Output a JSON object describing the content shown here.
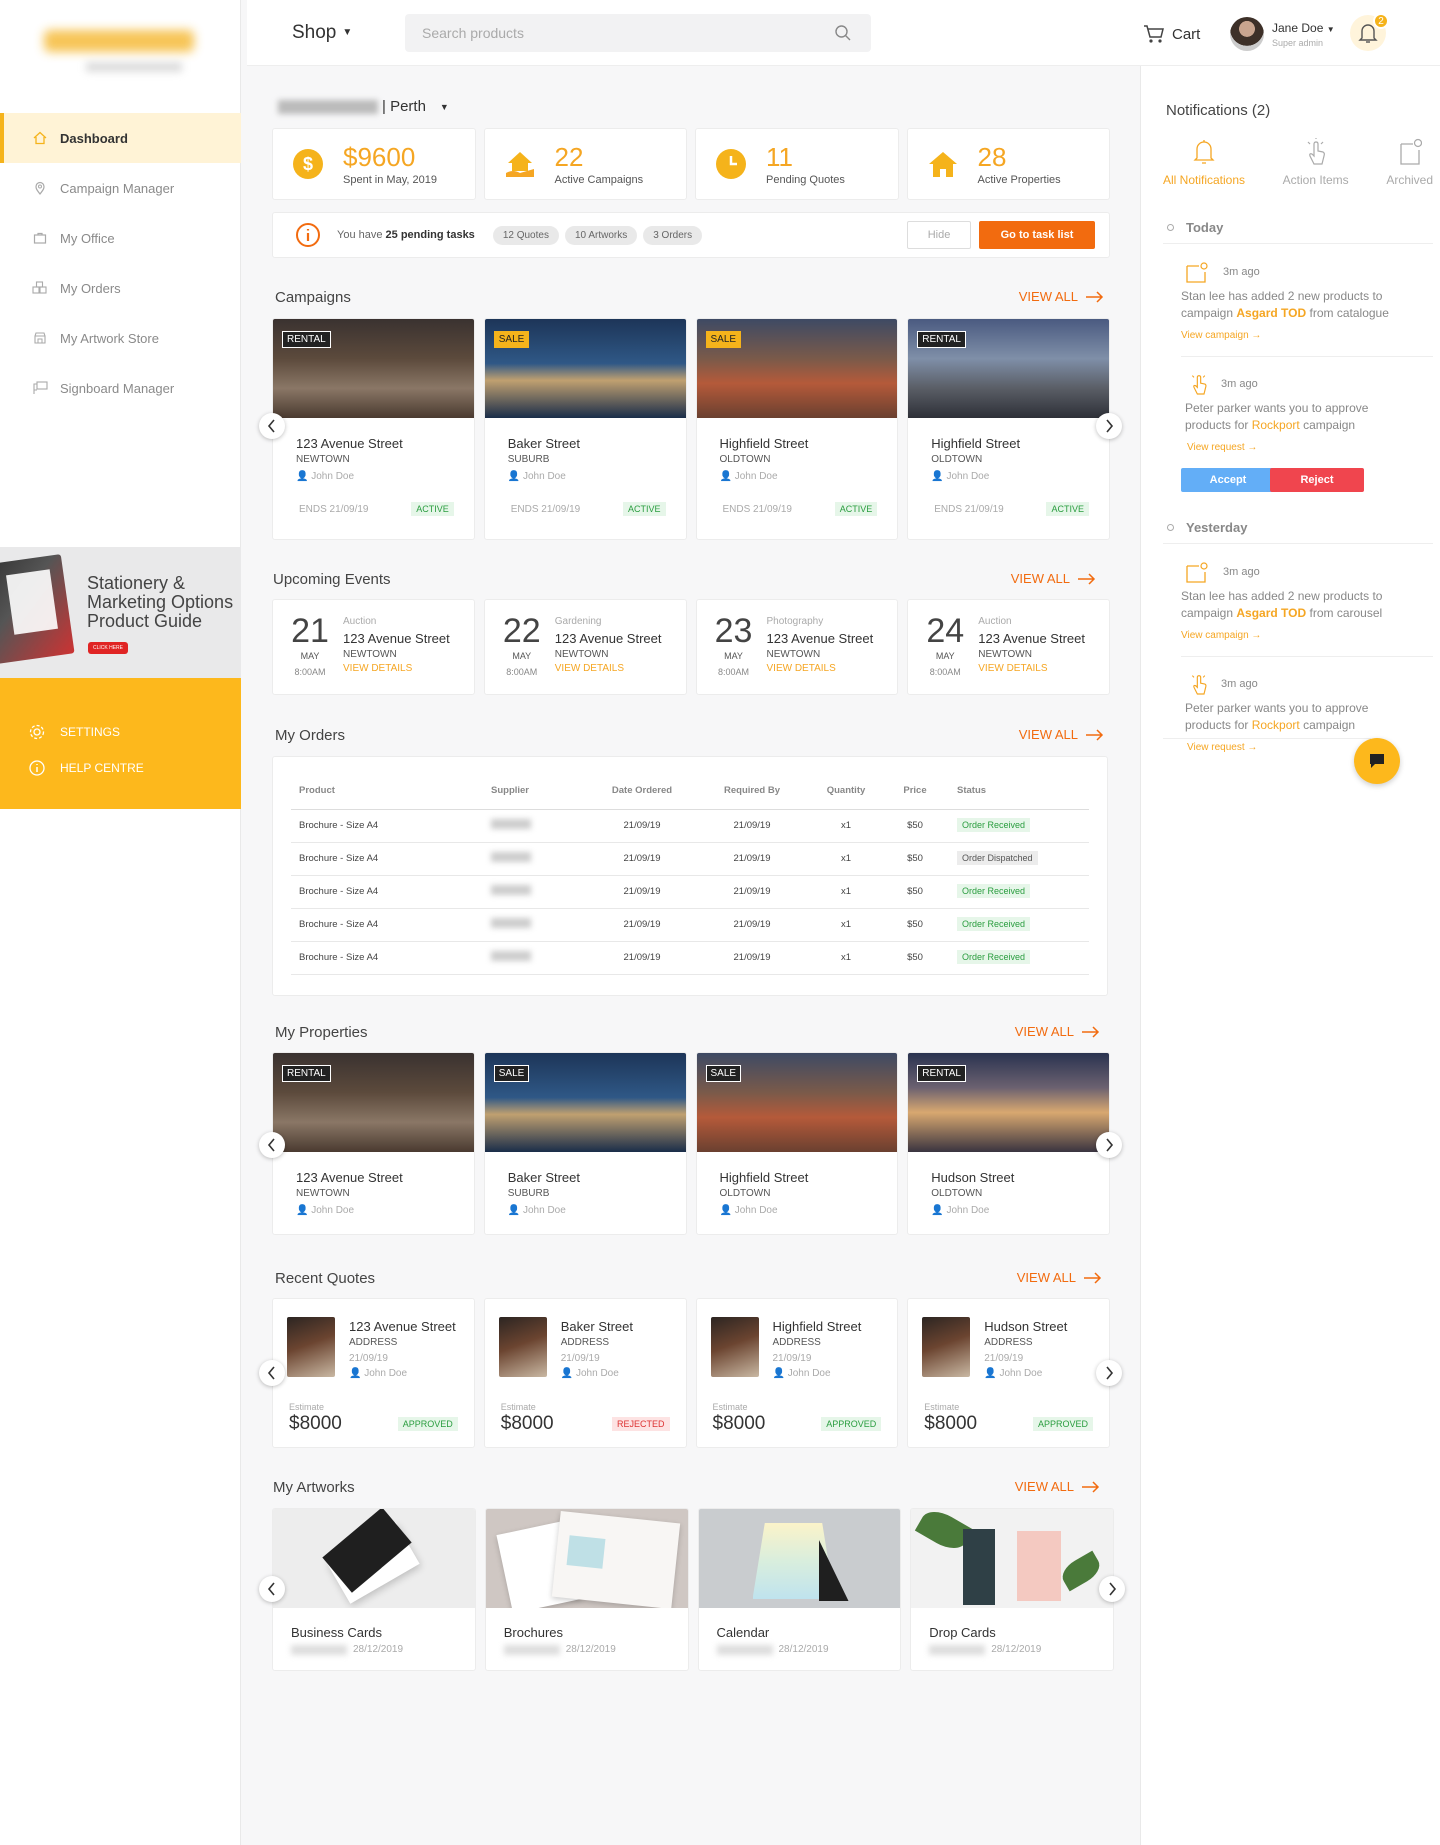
{
  "sidebar": {
    "nav": [
      {
        "label": "Dashboard",
        "icon": "home-icon",
        "active": true
      },
      {
        "label": "Campaign Manager",
        "icon": "location-pin-icon"
      },
      {
        "label": "My Office",
        "icon": "briefcase-icon"
      },
      {
        "label": "My Orders",
        "icon": "boxes-icon"
      },
      {
        "label": "My Artwork Store",
        "icon": "store-icon"
      },
      {
        "label": "Signboard Manager",
        "icon": "signboard-icon"
      }
    ],
    "promo": {
      "text": "Stationery & Marketing Options Product Guide",
      "button": "CLICK HERE"
    },
    "settings_label": "SETTINGS",
    "help_label": "HELP CENTRE"
  },
  "topbar": {
    "shop_label": "Shop",
    "search_placeholder": "Search products",
    "cart_label": "Cart",
    "user_name": "Jane Doe",
    "user_role": "Super admin",
    "bell_count": "2"
  },
  "location": {
    "city": "| Perth"
  },
  "stats": [
    {
      "value": "$9600",
      "label": "Spent in May, 2019",
      "icon": "dollar-icon"
    },
    {
      "value": "22",
      "label": "Active Campaigns",
      "icon": "house-hand-icon"
    },
    {
      "value": "11",
      "label": "Pending Quotes",
      "icon": "clock-icon"
    },
    {
      "value": "28",
      "label": "Active Properties",
      "icon": "house-icon"
    }
  ],
  "tasks": {
    "prefix": "You have",
    "count": "25 pending tasks",
    "pills": [
      "12 Quotes",
      "10 Artworks",
      "3 Orders"
    ],
    "hide_label": "Hide",
    "go_label": "Go to task list"
  },
  "view_all": "VIEW ALL",
  "campaigns": {
    "title": "Campaigns",
    "items": [
      {
        "tag": "RENTAL",
        "title": "123 Avenue Street",
        "suburb": "NEWTOWN",
        "agent": "John Doe",
        "ends": "ENDS 21/09/19",
        "status": "ACTIVE"
      },
      {
        "tag": "SALE",
        "title": "Baker Street",
        "suburb": "SUBURB",
        "agent": "John Doe",
        "ends": "ENDS 21/09/19",
        "status": "ACTIVE"
      },
      {
        "tag": "SALE",
        "title": "Highfield Street",
        "suburb": "OLDTOWN",
        "agent": "John Doe",
        "ends": "ENDS 21/09/19",
        "status": "ACTIVE"
      },
      {
        "tag": "RENTAL",
        "title": "Highfield Street",
        "suburb": "OLDTOWN",
        "agent": "John Doe",
        "ends": "ENDS 21/09/19",
        "status": "ACTIVE"
      }
    ]
  },
  "events": {
    "title": "Upcoming Events",
    "items": [
      {
        "day": "21",
        "month": "MAY",
        "time": "8:00AM",
        "category": "Auction",
        "title": "123 Avenue Street",
        "suburb": "NEWTOWN",
        "link": "VIEW DETAILS"
      },
      {
        "day": "22",
        "month": "MAY",
        "time": "8:00AM",
        "category": "Gardening",
        "title": "123 Avenue Street",
        "suburb": "NEWTOWN",
        "link": "VIEW DETAILS"
      },
      {
        "day": "23",
        "month": "MAY",
        "time": "8:00AM",
        "category": "Photography",
        "title": "123 Avenue Street",
        "suburb": "NEWTOWN",
        "link": "VIEW DETAILS"
      },
      {
        "day": "24",
        "month": "MAY",
        "time": "8:00AM",
        "category": "Auction",
        "title": "123 Avenue Street",
        "suburb": "NEWTOWN",
        "link": "VIEW DETAILS"
      }
    ]
  },
  "orders": {
    "title": "My Orders",
    "columns": [
      "Product",
      "Supplier",
      "Date Ordered",
      "Required By",
      "Quantity",
      "Price",
      "Status"
    ],
    "rows": [
      {
        "product": "Brochure - Size A4",
        "date": "21/09/19",
        "required": "21/09/19",
        "qty": "x1",
        "price": "$50",
        "status": "Order Received"
      },
      {
        "product": "Brochure - Size A4",
        "date": "21/09/19",
        "required": "21/09/19",
        "qty": "x1",
        "price": "$50",
        "status": "Order Dispatched"
      },
      {
        "product": "Brochure - Size A4",
        "date": "21/09/19",
        "required": "21/09/19",
        "qty": "x1",
        "price": "$50",
        "status": "Order Received"
      },
      {
        "product": "Brochure - Size A4",
        "date": "21/09/19",
        "required": "21/09/19",
        "qty": "x1",
        "price": "$50",
        "status": "Order Received"
      },
      {
        "product": "Brochure - Size A4",
        "date": "21/09/19",
        "required": "21/09/19",
        "qty": "x1",
        "price": "$50",
        "status": "Order Received"
      }
    ]
  },
  "properties": {
    "title": "My Properties",
    "items": [
      {
        "tag": "RENTAL",
        "title": "123 Avenue Street",
        "suburb": "NEWTOWN",
        "agent": "John Doe"
      },
      {
        "tag": "SALE",
        "title": "Baker Street",
        "suburb": "SUBURB",
        "agent": "John Doe"
      },
      {
        "tag": "SALE",
        "title": "Highfield Street",
        "suburb": "OLDTOWN",
        "agent": "John Doe"
      },
      {
        "tag": "RENTAL",
        "title": "Hudson Street",
        "suburb": "OLDTOWN",
        "agent": "John Doe"
      }
    ]
  },
  "quotes": {
    "title": "Recent Quotes",
    "items": [
      {
        "title": "123 Avenue Street",
        "sub": "ADDRESS",
        "date": "21/09/19",
        "agent": "John Doe",
        "est_label": "Estimate",
        "price": "$8000",
        "status": "APPROVED"
      },
      {
        "title": "Baker Street",
        "sub": "ADDRESS",
        "date": "21/09/19",
        "agent": "John Doe",
        "est_label": "Estimate",
        "price": "$8000",
        "status": "REJECTED"
      },
      {
        "title": "Highfield Street",
        "sub": "ADDRESS",
        "date": "21/09/19",
        "agent": "John Doe",
        "est_label": "Estimate",
        "price": "$8000",
        "status": "APPROVED"
      },
      {
        "title": "Hudson Street",
        "sub": "ADDRESS",
        "date": "21/09/19",
        "agent": "John Doe",
        "est_label": "Estimate",
        "price": "$8000",
        "status": "APPROVED"
      }
    ]
  },
  "artworks": {
    "title": "My Artworks",
    "items": [
      {
        "title": "Business Cards",
        "date": "28/12/2019"
      },
      {
        "title": "Brochures",
        "date": "28/12/2019"
      },
      {
        "title": "Calendar",
        "date": "28/12/2019"
      },
      {
        "title": "Drop Cards",
        "date": "28/12/2019"
      }
    ]
  },
  "notifications": {
    "title": "Notifications (2)",
    "tabs": [
      "All Notifications",
      "Action Items",
      "Archived"
    ],
    "today_label": "Today",
    "yesterday_label": "Yesterday",
    "items": [
      {
        "time": "3m ago",
        "text_a": "Stan lee has added 2 new products to campaign ",
        "highlight": "Asgard TOD",
        "text_b": " from catalogue",
        "link": "View campaign →"
      },
      {
        "time": "3m ago",
        "text_a": "Peter parker wants you to approve products for ",
        "highlight": "Rockport",
        "text_b": " campaign",
        "link": "View request →",
        "accept": "Accept",
        "reject": "Reject"
      },
      {
        "time": "3m ago",
        "text_a": "Stan lee has added 2 new products to campaign ",
        "highlight": "Asgard TOD",
        "text_b": " from carousel",
        "link": "View campaign →"
      },
      {
        "time": "3m ago",
        "text_a": "Peter parker wants you to approve products for ",
        "highlight": "Rockport",
        "text_b": " campaign",
        "link": "View request →"
      }
    ]
  },
  "colors": {
    "accent": "#f5b31b",
    "orange": "#f26b0f",
    "active_green": "#2a9d3f",
    "accept_blue": "#63aef7",
    "reject_red": "#f0454e"
  }
}
